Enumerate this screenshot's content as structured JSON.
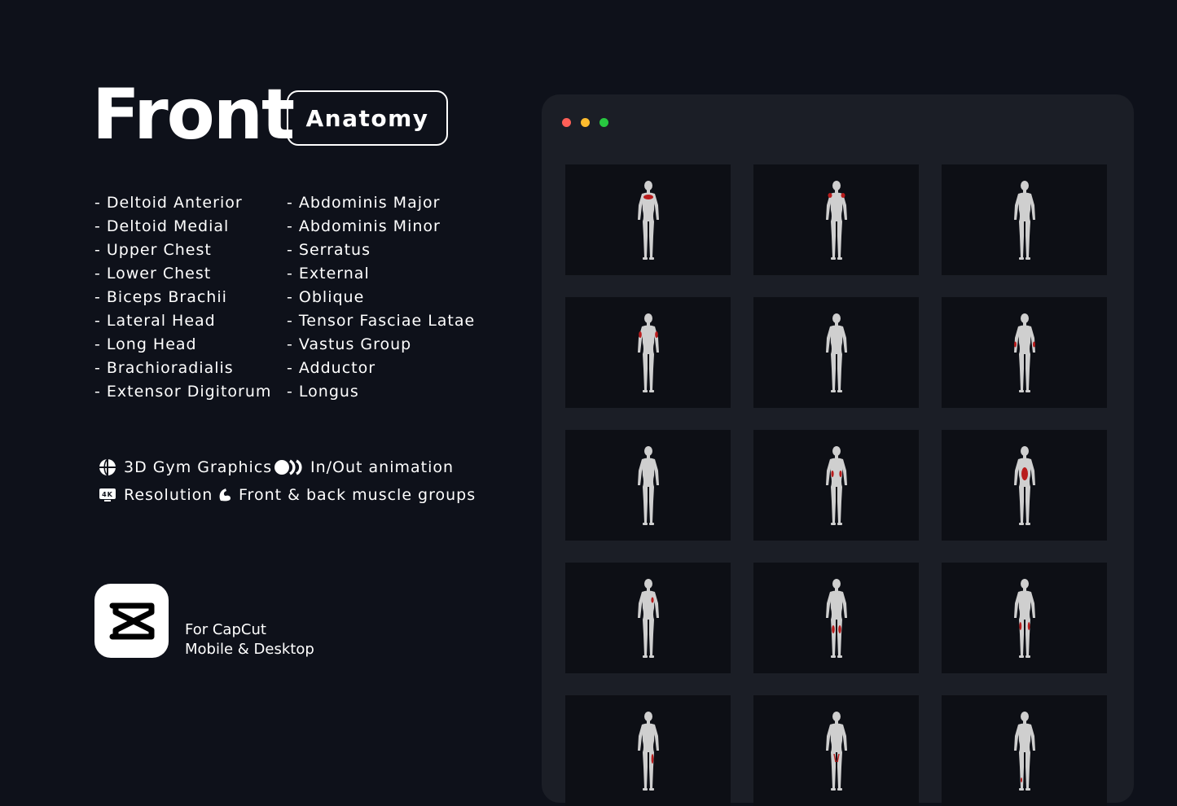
{
  "header": {
    "title": "Front",
    "badge": "Anatomy"
  },
  "muscles": {
    "left": [
      "- Deltoid Anterior",
      "- Deltoid Medial",
      "- Upper Chest",
      "- Lower Chest",
      "- Biceps Brachii",
      "- Lateral Head",
      "- Long Head",
      "- Brachioradialis",
      "- Extensor Digitorum"
    ],
    "right": [
      "- Abdominis Major",
      "- Abdominis Minor",
      "- Serratus",
      "- External",
      "- Oblique",
      "- Tensor Fasciae Latae",
      "- Vastus Group",
      "- Adductor",
      "- Longus"
    ]
  },
  "features": {
    "gym_graphics": "3D Gym Graphics",
    "animation": "In/Out animation",
    "resolution": "Resolution",
    "resolution_badge": "4K",
    "muscle_groups": "Front & back muscle groups"
  },
  "capcut": {
    "line1": "For CapCut",
    "line2": "Mobile & Desktop"
  },
  "window": {
    "dot_colors": [
      "#ff5f57",
      "#febc2e",
      "#28c840"
    ]
  },
  "tiles": [
    "upper-chest",
    "front-deltoid",
    "none",
    "biceps",
    "none",
    "forearm",
    "none",
    "oblique",
    "abdominals",
    "serratus",
    "vastus",
    "outer-thigh",
    "adductor",
    "inner-thigh",
    "shin"
  ],
  "colors": {
    "background": "#0e111a",
    "window": "#1b1e26",
    "tile": "#0d0f15",
    "highlight": "#b81c1c",
    "figure": "#cfcfcf"
  }
}
